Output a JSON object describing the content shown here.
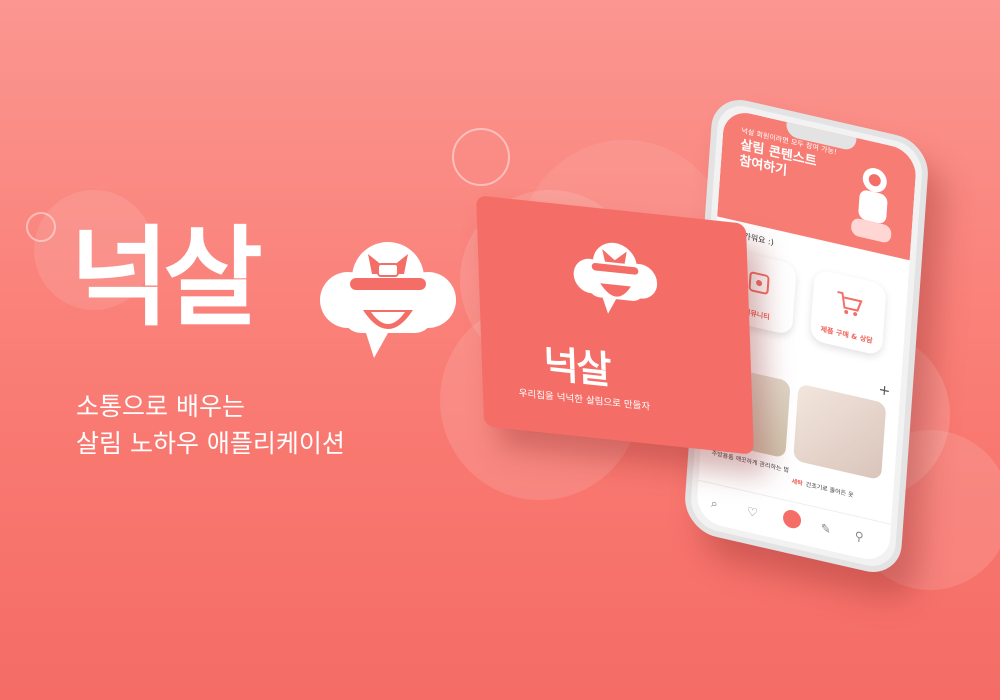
{
  "brand": {
    "title": "넉살",
    "tagline_line1": "소통으로 배우는",
    "tagline_line2": "살림 노하우 애플리케이션"
  },
  "card": {
    "title": "넉살",
    "slogan": "우리집을 넉넉한 살림으로 만들자"
  },
  "app": {
    "banner": {
      "small": "넉살 회원이라면 모두 참여 가능!",
      "title_line1": "살림 콘텐스트",
      "title_line2": "참여하기"
    },
    "greeting": "님 반가워요 :)",
    "tiles": [
      {
        "label": "커뮤니티"
      },
      {
        "label": "제품 구매 & 상담"
      }
    ],
    "plus_label": "+",
    "posts": [
      {
        "tag": "",
        "caption": "주방용품 깨끗하게 관리하는 법"
      },
      {
        "tag": "세탁",
        "caption": "건조기로 줄어든 옷"
      }
    ],
    "tabs": [
      "search-icon",
      "heart-icon",
      "home-logo-icon",
      "pencil-icon",
      "user-icon"
    ]
  },
  "colors": {
    "accent": "#f46e67",
    "background_top": "#fb9690",
    "background_bottom": "#f46c65"
  }
}
